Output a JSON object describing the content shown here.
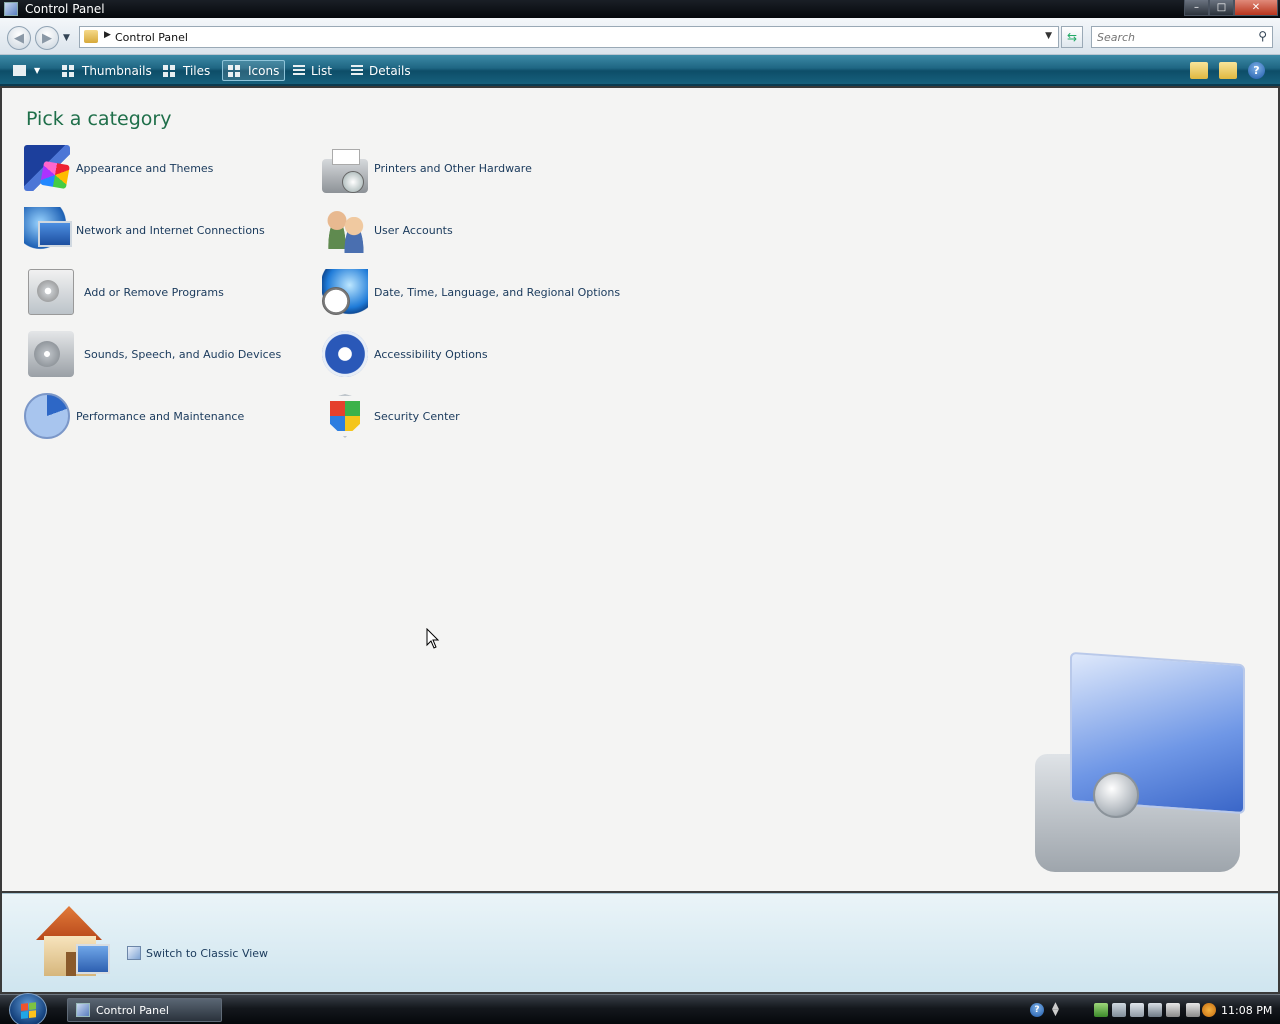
{
  "window": {
    "title": "Control Panel",
    "controls": {
      "minimize": "–",
      "maximize": "□",
      "close": "✕"
    }
  },
  "address_bar": {
    "path": "Control Panel",
    "search_placeholder": "Search"
  },
  "toolbar": {
    "views": [
      {
        "label": "Thumbnails"
      },
      {
        "label": "Tiles"
      },
      {
        "label": "Icons"
      },
      {
        "label": "List"
      },
      {
        "label": "Details"
      }
    ],
    "active_view": "Icons",
    "help_glyph": "?"
  },
  "content": {
    "heading": "Pick a category",
    "categories_left": [
      {
        "label": "Appearance and Themes",
        "icon": "appearance-themes-icon"
      },
      {
        "label": "Network and Internet Connections",
        "icon": "network-icon"
      },
      {
        "label": "Add or Remove Programs",
        "icon": "add-remove-programs-icon"
      },
      {
        "label": "Sounds, Speech, and Audio Devices",
        "icon": "sounds-icon"
      },
      {
        "label": "Performance and Maintenance",
        "icon": "performance-icon"
      }
    ],
    "categories_right": [
      {
        "label": "Printers and Other Hardware",
        "icon": "printer-icon"
      },
      {
        "label": "User Accounts",
        "icon": "user-accounts-icon"
      },
      {
        "label": "Date, Time, Language, and Regional Options",
        "icon": "date-time-globe-icon"
      },
      {
        "label": "Accessibility Options",
        "icon": "accessibility-icon"
      },
      {
        "label": "Security Center",
        "icon": "security-shield-icon"
      }
    ]
  },
  "bottom_panel": {
    "switch_label": "Switch to Classic View"
  },
  "taskbar": {
    "task_label": "Control Panel",
    "clock": "11:08 PM",
    "help_glyph": "?"
  },
  "colors": {
    "heading": "#1f6f4a",
    "link": "#1a3a5c",
    "toolbar": "#1f6683",
    "content_bg": "#f4f4f3"
  }
}
